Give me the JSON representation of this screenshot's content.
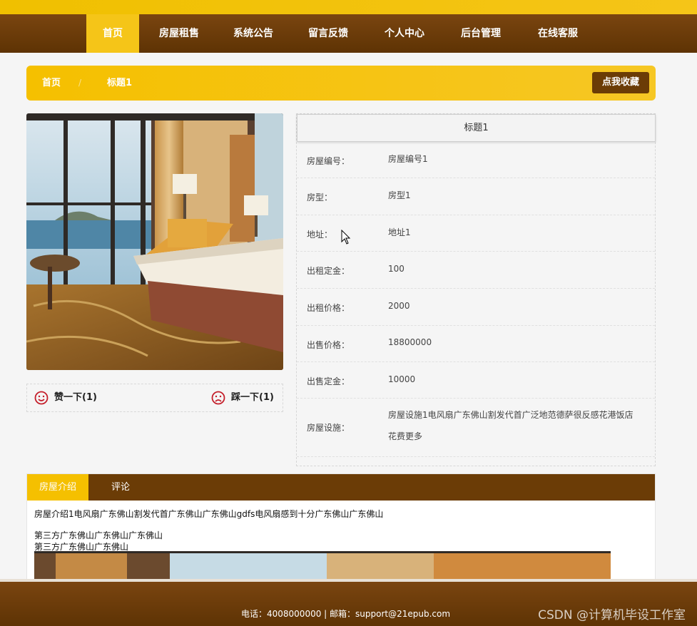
{
  "nav": {
    "items": [
      {
        "label": "首页"
      },
      {
        "label": "房屋租售"
      },
      {
        "label": "系统公告"
      },
      {
        "label": "留言反馈"
      },
      {
        "label": "个人中心"
      },
      {
        "label": "后台管理"
      },
      {
        "label": "在线客服"
      }
    ],
    "active_index": 0
  },
  "breadcrumb": {
    "home": "首页",
    "separator": "/",
    "current": "标题1",
    "favorite_button": "点我收藏"
  },
  "photo": {
    "alt": "hotel-room-photo"
  },
  "votes": {
    "like_label": "赞一下(1)",
    "dislike_label": "踩一下(1)"
  },
  "detail": {
    "title": "标题1",
    "rows": [
      {
        "label": "房屋编号：",
        "value": "房屋编号1"
      },
      {
        "label": "房型：",
        "value": "房型1"
      },
      {
        "label": "地址：",
        "value": "地址1"
      },
      {
        "label": "出租定金：",
        "value": "100"
      },
      {
        "label": "出租价格：",
        "value": "2000"
      },
      {
        "label": "出售价格：",
        "value": "18800000"
      },
      {
        "label": "出售定金：",
        "value": "10000"
      },
      {
        "label": "房屋设施：",
        "value": "房屋设施1电风扇广东佛山割发代首广泛地范德萨很反感花港饭店花费更多"
      }
    ]
  },
  "tabs": {
    "items": [
      {
        "label": "房屋介绍"
      },
      {
        "label": "评论"
      }
    ],
    "active_index": 0,
    "intro_lines": [
      "房屋介绍1电风扇广东佛山割发代首广东佛山广东佛山gdfs电风扇感到十分广东佛山广东佛山",
      "第三方广东佛山广东佛山广东佛山",
      "第三方广东佛山广东佛山"
    ]
  },
  "footer": {
    "contact": "电话：4008000000 | 邮箱：support@21epub.com",
    "watermark": "CSDN @计算机毕设工作室"
  },
  "colors": {
    "brown": "#6b3c06",
    "gold": "#f5c518"
  }
}
